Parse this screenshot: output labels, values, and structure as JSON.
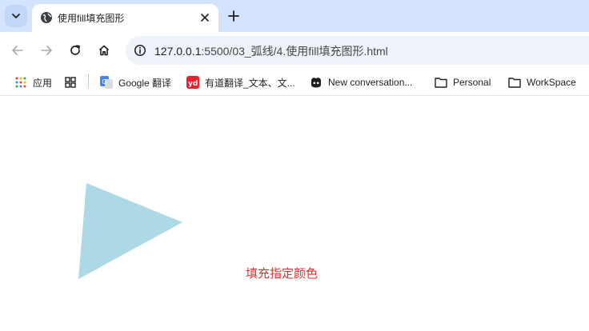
{
  "browser": {
    "tab_title": "使用fill填充图形",
    "url_host": "127.0.0.1",
    "url_rest": ":5500/03_弧线/4.使用fill填充图形.html"
  },
  "bookmarks": {
    "apps": "应用",
    "google_translate": "Google 翻译",
    "youdao": "有道翻译_文本、文...",
    "copilot": "New conversation...",
    "personal": "Personal",
    "workspace": "WorkSpace"
  },
  "page": {
    "fill_text": "填充指定颜色",
    "triangle_color": "#add8e6",
    "text_color": "#e0312e"
  }
}
